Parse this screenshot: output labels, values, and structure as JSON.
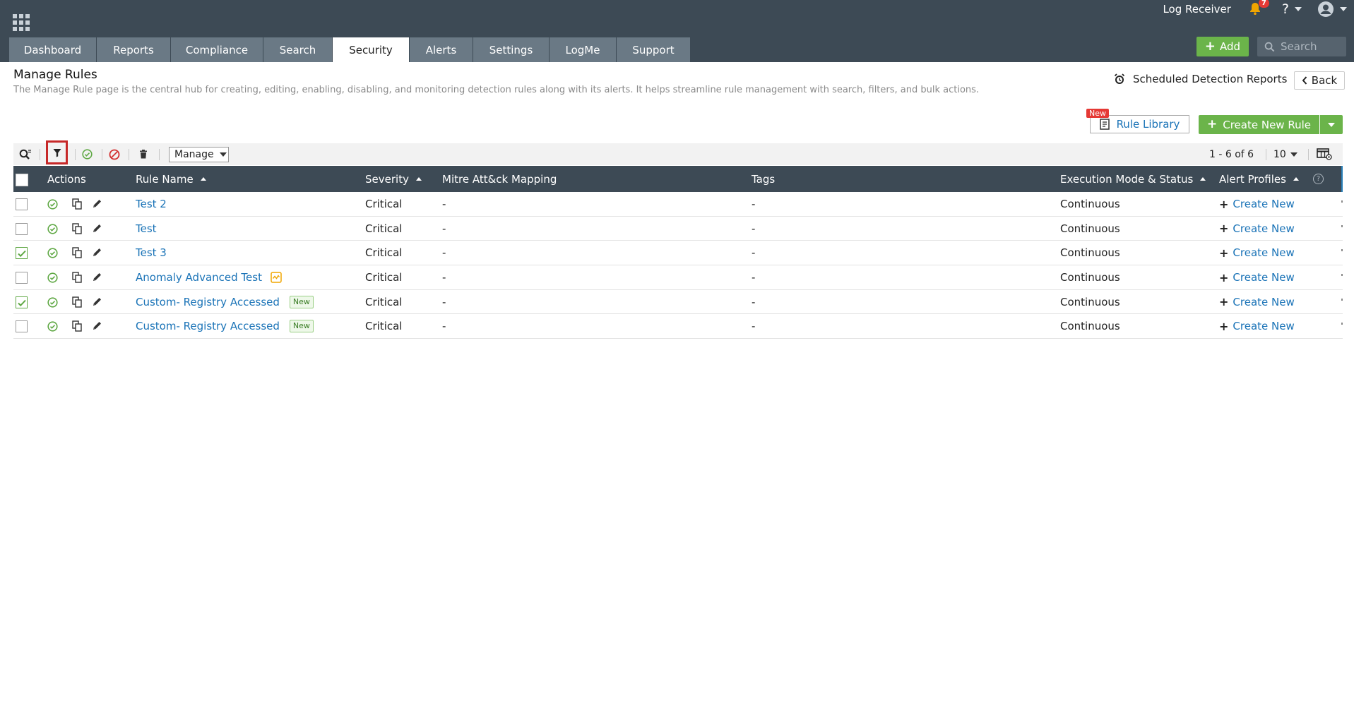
{
  "header": {
    "log_receiver": "Log Receiver",
    "notification_count": "7",
    "help": "?",
    "add_label": "Add",
    "search_placeholder": "Search"
  },
  "nav": {
    "tabs": [
      {
        "label": "Dashboard"
      },
      {
        "label": "Reports"
      },
      {
        "label": "Compliance"
      },
      {
        "label": "Search"
      },
      {
        "label": "Security",
        "active": true
      },
      {
        "label": "Alerts"
      },
      {
        "label": "Settings"
      },
      {
        "label": "LogMe"
      },
      {
        "label": "Support"
      }
    ]
  },
  "page": {
    "title": "Manage Rules",
    "description": "The Manage Rule page is the central hub for creating, editing, enabling, disabling, and monitoring detection rules along with its alerts. It helps streamline rule management with search, filters, and bulk actions.",
    "scheduled_reports": "Scheduled Detection Reports",
    "back": "Back",
    "new_flag": "New",
    "rule_library": "Rule Library",
    "create_new_rule": "Create New Rule"
  },
  "toolbar": {
    "manage_label": "Manage",
    "pager": "1 - 6 of 6",
    "per_page": "10"
  },
  "table": {
    "columns": {
      "actions": "Actions",
      "rule_name": "Rule Name",
      "severity": "Severity",
      "mitre": "Mitre Att&ck Mapping",
      "tags": "Tags",
      "execution": "Execution Mode & Status",
      "alert_profiles": "Alert Profiles"
    },
    "rows": [
      {
        "name": "Test 2",
        "severity": "Critical",
        "mitre": "-",
        "tags": "-",
        "execution": "Continuous",
        "alert": "Create New",
        "checked": false,
        "badge": ""
      },
      {
        "name": "Test",
        "severity": "Critical",
        "mitre": "-",
        "tags": "-",
        "execution": "Continuous",
        "alert": "Create New",
        "checked": false,
        "badge": ""
      },
      {
        "name": "Test 3",
        "severity": "Critical",
        "mitre": "-",
        "tags": "-",
        "execution": "Continuous",
        "alert": "Create New",
        "checked": true,
        "badge": ""
      },
      {
        "name": "Anomaly Advanced Test",
        "severity": "Critical",
        "mitre": "-",
        "tags": "-",
        "execution": "Continuous",
        "alert": "Create New",
        "checked": false,
        "badge": "anomaly"
      },
      {
        "name": "Custom- Registry Accessed",
        "severity": "Critical",
        "mitre": "-",
        "tags": "-",
        "execution": "Continuous",
        "alert": "Create New",
        "checked": true,
        "badge": "New"
      },
      {
        "name": "Custom- Registry Accessed",
        "severity": "Critical",
        "mitre": "-",
        "tags": "-",
        "execution": "Continuous",
        "alert": "Create New",
        "checked": false,
        "badge": "New"
      }
    ]
  },
  "colors": {
    "topbar": "#3d4a55",
    "tab": "#6a7985",
    "accent_green": "#6bb44a",
    "link_blue": "#1a73b7",
    "highlight_red": "#c62828"
  }
}
